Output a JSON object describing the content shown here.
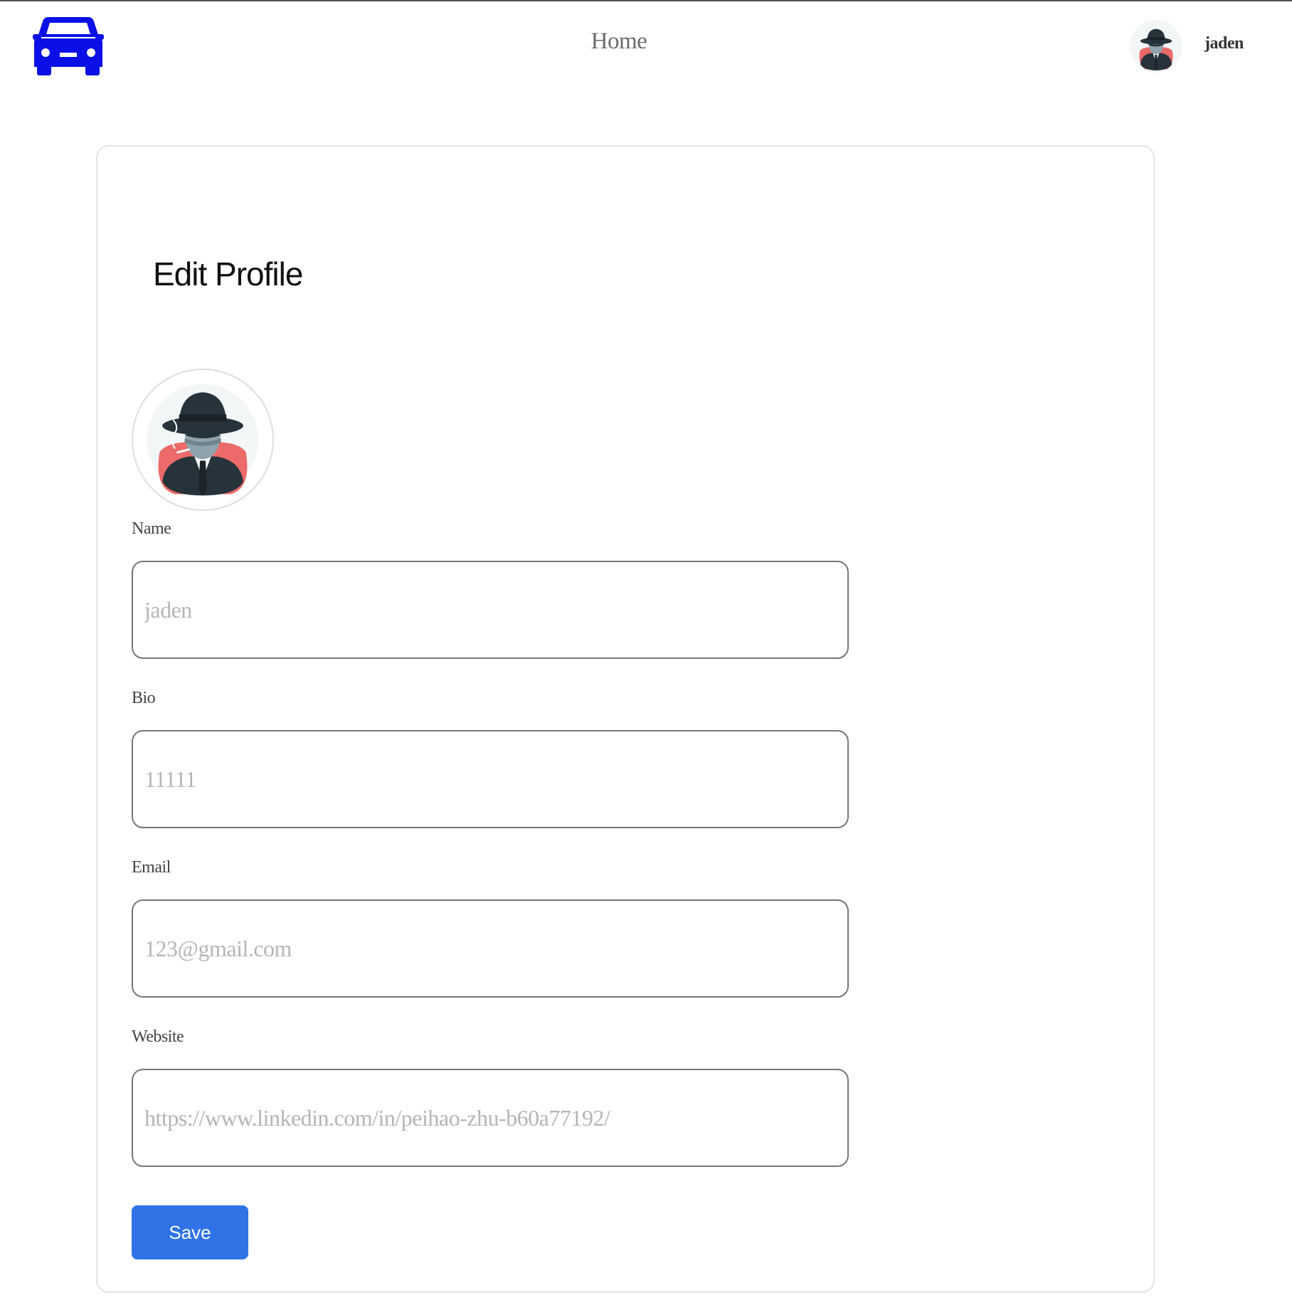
{
  "header": {
    "logo_icon": "car-icon",
    "logo_color": "#0a10e6",
    "nav_home_label": "Home",
    "user": {
      "name": "jaden",
      "avatar_icon": "detective-avatar-icon"
    }
  },
  "edit_profile": {
    "title": "Edit Profile",
    "photo_icon": "detective-avatar-icon",
    "fields": [
      {
        "label": "Name",
        "placeholder": "jaden",
        "value": ""
      },
      {
        "label": "Bio",
        "placeholder": "11111",
        "value": ""
      },
      {
        "label": "Email",
        "placeholder": "123@gmail.com",
        "value": ""
      },
      {
        "label": "Website",
        "placeholder": "https://www.linkedin.com/in/peihao-zhu-b60a77192/",
        "value": ""
      }
    ],
    "save_label": "Save",
    "save_color": "#2f73e6"
  }
}
